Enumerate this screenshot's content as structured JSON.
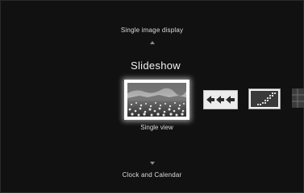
{
  "menu": {
    "up_option": "Single image display",
    "title": "Slideshow",
    "selected_effect": "Single view",
    "down_option": "Clock and Calendar"
  },
  "effects": [
    {
      "icon": "single-view-icon",
      "selected": true
    },
    {
      "icon": "arrows-icon",
      "selected": false
    },
    {
      "icon": "mosaic-icon",
      "selected": false
    },
    {
      "icon": "grid-icon",
      "selected": false
    }
  ],
  "colors": {
    "background": "#111111",
    "text": "#dcdcdc",
    "highlight": "#ffffff"
  }
}
